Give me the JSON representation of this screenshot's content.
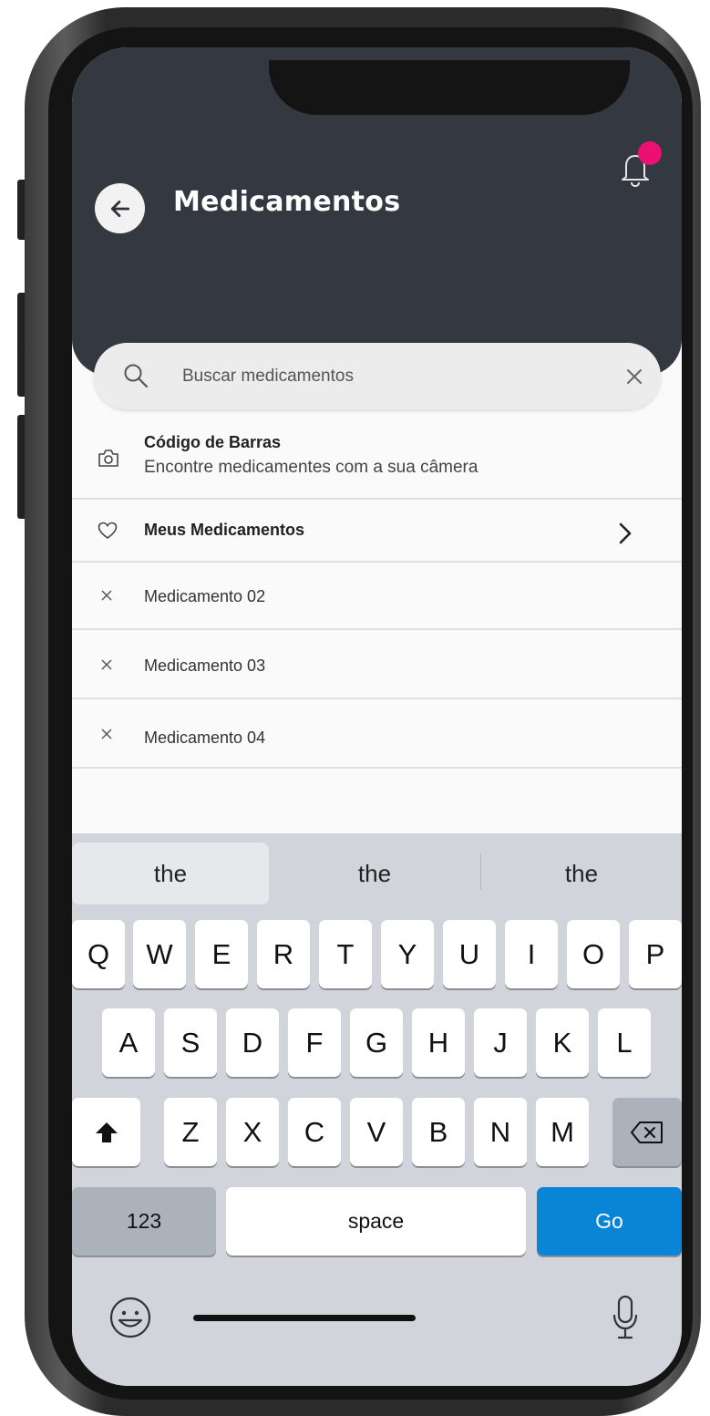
{
  "header": {
    "title": "Medicamentos",
    "background": "#343941",
    "notification_dot_color": "#ec0f74"
  },
  "search": {
    "placeholder": "Buscar medicamentos"
  },
  "list": {
    "barcode": {
      "title": "Código de Barras",
      "subtitle": "Encontre medicamentes com a sua câmera",
      "icon": "camera-icon"
    },
    "favorites": {
      "title": "Meus Medicamentos",
      "icon": "heart-icon"
    },
    "recent": [
      {
        "label": "Medicamento 02"
      },
      {
        "label": "Medicamento 03"
      },
      {
        "label": "Medicamento 04"
      }
    ]
  },
  "keyboard": {
    "suggestions": [
      "the",
      "the",
      "the"
    ],
    "row1": [
      "Q",
      "W",
      "E",
      "R",
      "T",
      "Y",
      "U",
      "I",
      "O",
      "P"
    ],
    "row2": [
      "A",
      "S",
      "D",
      "F",
      "G",
      "H",
      "J",
      "K",
      "L"
    ],
    "row3": [
      "Z",
      "X",
      "C",
      "V",
      "B",
      "N",
      "M"
    ],
    "numbers_label": "123",
    "space_label": "space",
    "go_label": "Go",
    "go_color": "#0a84d4"
  }
}
